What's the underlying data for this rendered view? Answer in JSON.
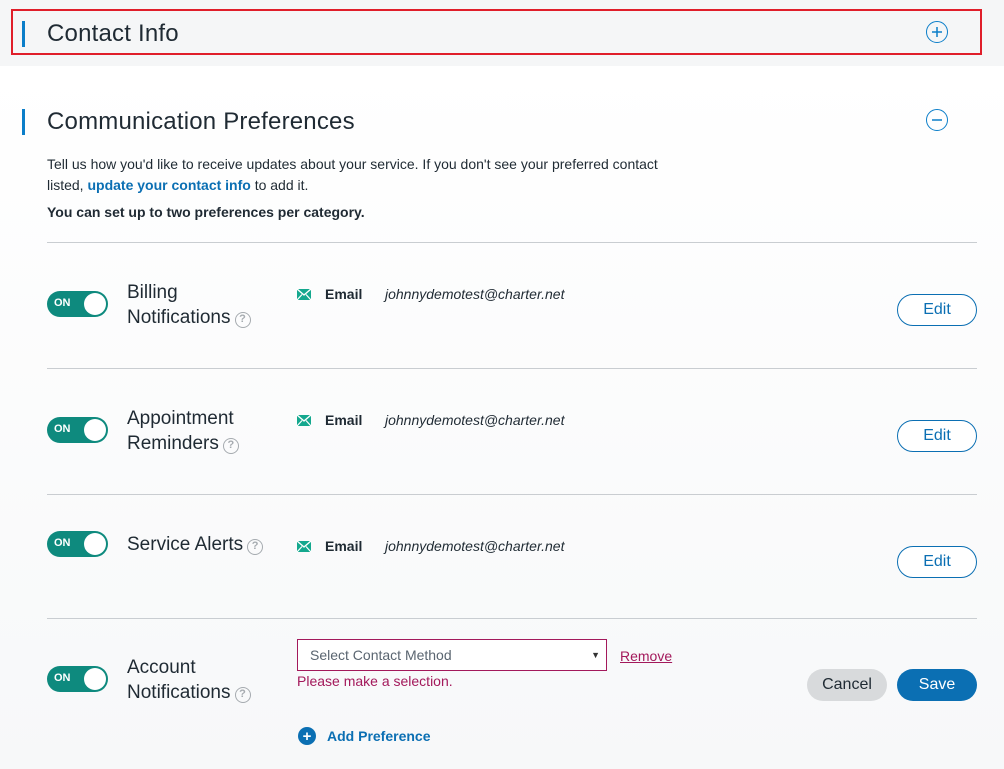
{
  "contact_info": {
    "title": "Contact Info",
    "expand_icon": "plus-circle-icon"
  },
  "communication": {
    "title": "Communication Preferences",
    "collapse_icon": "minus-circle-icon",
    "description_part1": "Tell us how you'd like to receive updates about your service. If you don't see your preferred contact listed, ",
    "description_link": "update your contact info",
    "description_part2": " to add it.",
    "limit_note": "You can set up to two preferences per category."
  },
  "preferences": [
    {
      "toggle_label": "ON",
      "name_line1": "Billing",
      "name_line2": "Notifications",
      "method": "Email",
      "contact": "johnnydemotest@charter.net",
      "edit_label": "Edit"
    },
    {
      "toggle_label": "ON",
      "name_line1": "Appointment",
      "name_line2": "Reminders",
      "method": "Email",
      "contact": "johnnydemotest@charter.net",
      "edit_label": "Edit"
    },
    {
      "toggle_label": "ON",
      "name_line1": "Service Alerts",
      "method": "Email",
      "contact": "johnnydemotest@charter.net",
      "edit_label": "Edit"
    }
  ],
  "account_notifications": {
    "toggle_label": "ON",
    "name_line1": "Account",
    "name_line2": "Notifications",
    "select_placeholder": "Select Contact Method",
    "remove_label": "Remove",
    "error": "Please make a selection.",
    "cancel_label": "Cancel",
    "save_label": "Save",
    "add_label": "Add Preference"
  },
  "colors": {
    "accent": "#0b7ec9",
    "toggle_on": "#0e8a7e",
    "error": "#a3195b",
    "highlight_border": "#e01e2a"
  }
}
